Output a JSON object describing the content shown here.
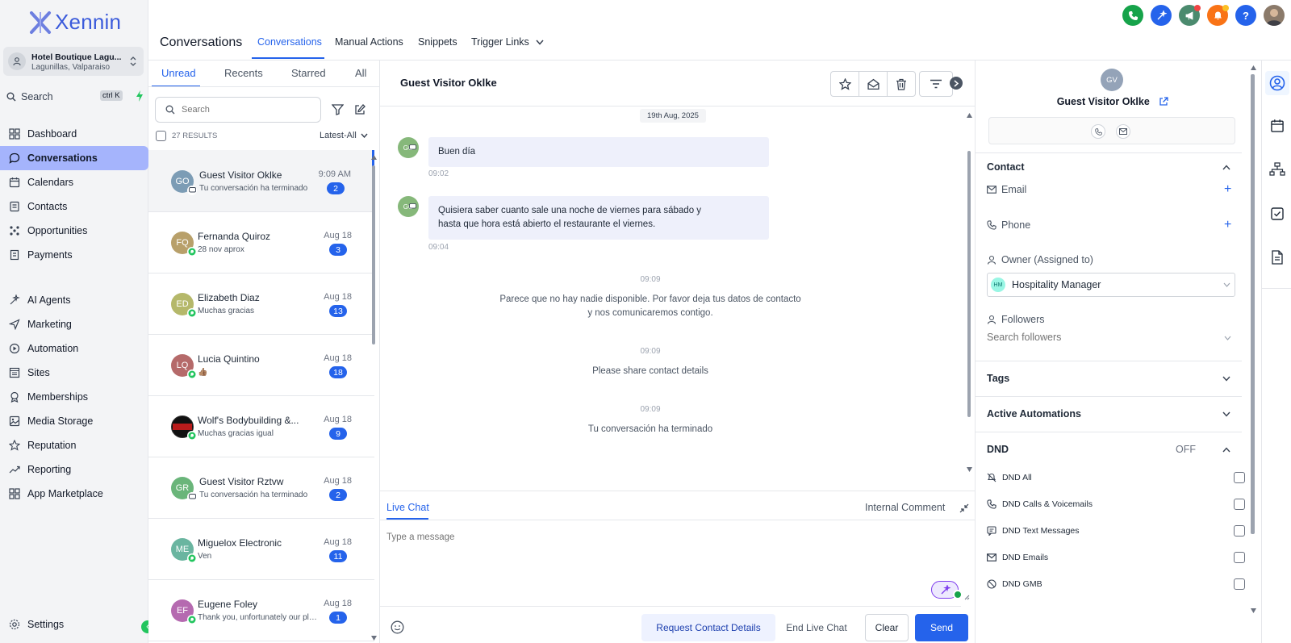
{
  "brand": {
    "logo_text": "Xennin"
  },
  "location": {
    "name": "Hotel Boutique Lagu...",
    "address": "Lagunillas, Valparaiso"
  },
  "sidebar": {
    "search_label": "Search",
    "search_shortcut": "ctrl K",
    "items": [
      {
        "label": "Dashboard",
        "icon": "grid-icon"
      },
      {
        "label": "Conversations",
        "icon": "chat-bubble-icon",
        "active": true
      },
      {
        "label": "Calendars",
        "icon": "calendar-icon"
      },
      {
        "label": "Contacts",
        "icon": "contacts-icon"
      },
      {
        "label": "Opportunities",
        "icon": "opportunities-icon"
      },
      {
        "label": "Payments",
        "icon": "payments-icon"
      },
      {
        "label": "AI Agents",
        "icon": "ai-sparkle-icon"
      },
      {
        "label": "Marketing",
        "icon": "send-icon"
      },
      {
        "label": "Automation",
        "icon": "automation-icon"
      },
      {
        "label": "Sites",
        "icon": "sites-icon"
      },
      {
        "label": "Memberships",
        "icon": "memberships-icon"
      },
      {
        "label": "Media Storage",
        "icon": "image-icon"
      },
      {
        "label": "Reputation",
        "icon": "star-icon"
      },
      {
        "label": "Reporting",
        "icon": "trend-icon"
      },
      {
        "label": "App Marketplace",
        "icon": "apps-icon"
      }
    ],
    "settings_label": "Settings"
  },
  "header": {
    "title": "Conversations",
    "tabs": [
      {
        "label": "Conversations",
        "active": true
      },
      {
        "label": "Manual Actions"
      },
      {
        "label": "Snippets"
      },
      {
        "label": "Trigger Links"
      }
    ]
  },
  "list": {
    "tabs": [
      "Unread",
      "Recents",
      "Starred",
      "All"
    ],
    "search_placeholder": "Search",
    "results": "27 RESULTS",
    "sort": "Latest-All",
    "conversations": [
      {
        "initials": "GO",
        "name": "Guest Visitor Oklke",
        "preview": "Tu conversación ha terminado",
        "time": "9:09 AM",
        "count": "2",
        "color": "#7c9cb5",
        "channel": "chat"
      },
      {
        "initials": "FQ",
        "name": "Fernanda Quiroz",
        "preview": "28 nov aprox",
        "time": "Aug 18",
        "count": "3",
        "color": "#b8a06a",
        "channel": "whatsapp"
      },
      {
        "initials": "ED",
        "name": "Elizabeth Diaz",
        "preview": "Muchas gracias",
        "time": "Aug 18",
        "count": "13",
        "color": "#b5b86a",
        "channel": "whatsapp"
      },
      {
        "initials": "LQ",
        "name": "Lucia Quintino",
        "preview": "👍🏽",
        "time": "Aug 18",
        "count": "18",
        "color": "#b56a6a",
        "channel": "whatsapp"
      },
      {
        "initials": "",
        "name": "Wolf's Bodybuilding &...",
        "preview": "Muchas gracias igual",
        "time": "Aug 18",
        "count": "9",
        "color": "#111111",
        "channel": "whatsapp"
      },
      {
        "initials": "GR",
        "name": "Guest Visitor Rztvw",
        "preview": "Tu conversación ha terminado",
        "time": "Aug 18",
        "count": "2",
        "color": "#6ab57a",
        "channel": "chat"
      },
      {
        "initials": "ME",
        "name": "Miguelox Electronic",
        "preview": "Ven",
        "time": "Aug 18",
        "count": "11",
        "color": "#6ab5a0",
        "channel": "whatsapp"
      },
      {
        "initials": "EF",
        "name": "Eugene Foley",
        "preview": "Thank you, unfortunately our plans",
        "time": "Aug 18",
        "count": "1",
        "color": "#b56ab0",
        "channel": "whatsapp"
      }
    ]
  },
  "chat": {
    "title": "Guest Visitor Oklke",
    "date": "19th Aug, 2025",
    "messages": [
      {
        "avatar": "GO",
        "text": "Buen día",
        "time": "09:02"
      },
      {
        "avatar": "GO",
        "text": "Quisiera saber cuanto sale una noche de viernes para sábado y hasta que hora está abierto el restaurante el viernes.",
        "time": "09:04"
      }
    ],
    "system": [
      {
        "time": "09:09",
        "text": "Parece que no hay nadie disponible. Por favor deja tus datos de contacto y nos comunicaremos contigo."
      },
      {
        "time": "09:09",
        "text": "Please share contact details"
      },
      {
        "time": "09:09",
        "text": "Tu conversación ha terminado"
      }
    ],
    "composer": {
      "tab_live": "Live Chat",
      "tab_internal": "Internal Comment",
      "placeholder": "Type a message",
      "request_label": "Request Contact Details",
      "end_label": "End Live Chat",
      "clear_label": "Clear",
      "send_label": "Send"
    }
  },
  "contact": {
    "initials": "GV",
    "name": "Guest Visitor Oklke",
    "section_contact": "Contact",
    "email_label": "Email",
    "phone_label": "Phone",
    "owner_label": "Owner (Assigned to)",
    "owner_initials": "HM",
    "owner_value": "Hospitality Manager",
    "followers_label": "Followers",
    "followers_placeholder": "Search followers",
    "tags_label": "Tags",
    "automations_label": "Active Automations",
    "dnd_label": "DND",
    "dnd_state": "OFF",
    "dnd_items": [
      "DND All",
      "DND Calls & Voicemails",
      "DND Text Messages",
      "DND Emails",
      "DND GMB"
    ]
  },
  "colors": {
    "accent": "#2563eb",
    "active_nav": "#a5b4fc",
    "whatsapp": "#22c55e"
  }
}
